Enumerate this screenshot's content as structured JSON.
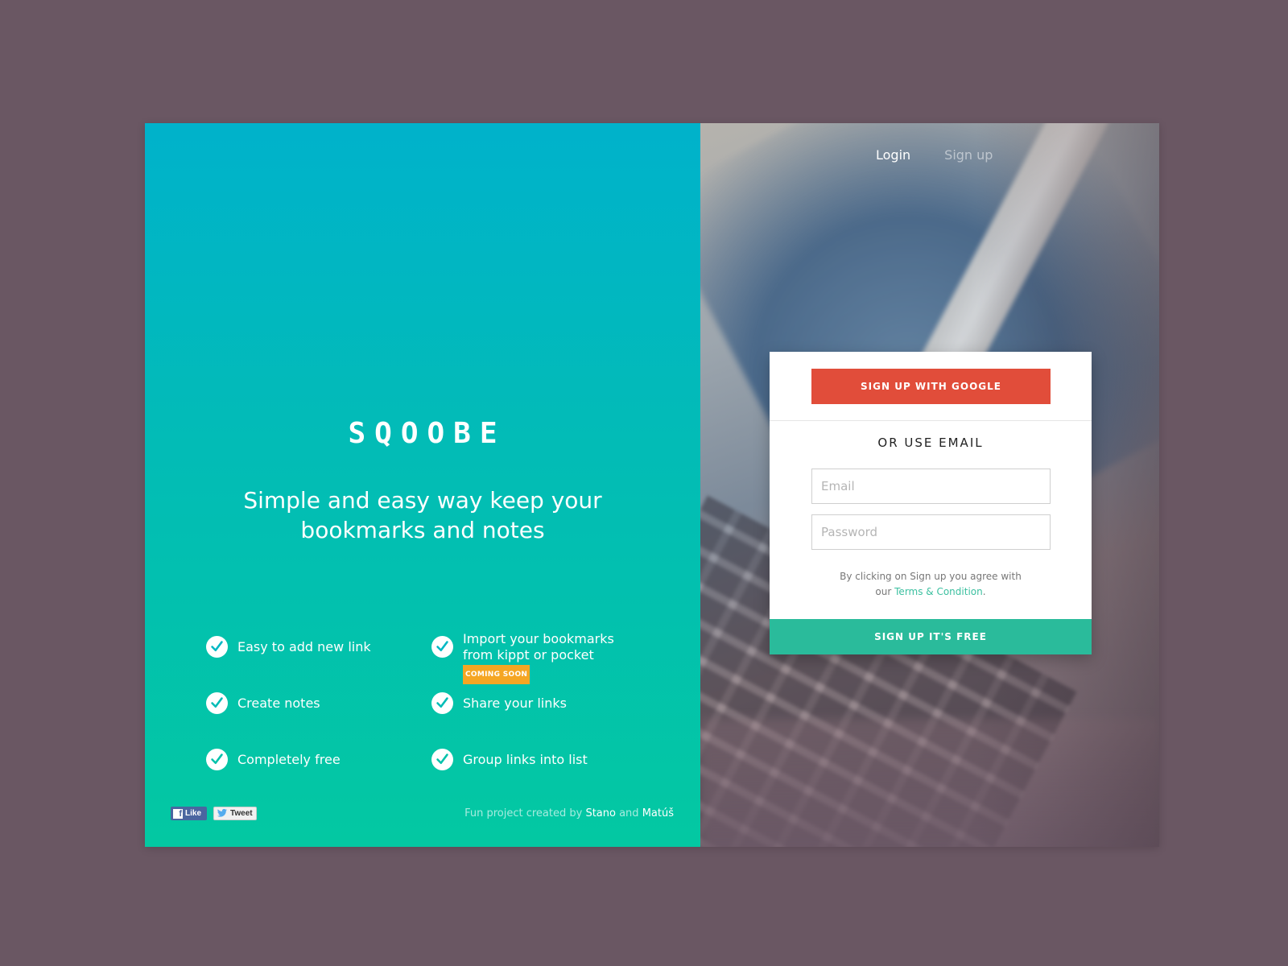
{
  "brand": {
    "logo": "SQOOBE"
  },
  "hero": {
    "tagline_line1": "Simple and easy way keep your",
    "tagline_line2": "bookmarks and notes"
  },
  "features": [
    {
      "label": "Easy to add new link"
    },
    {
      "label_line1": "Import your bookmarks",
      "label_line2": "from kippt or pocket",
      "badge": "COMING SOON"
    },
    {
      "label": "Create notes"
    },
    {
      "label": "Share your links"
    },
    {
      "label": "Completely free"
    },
    {
      "label": "Group links into list"
    }
  ],
  "social": {
    "like_label": "Like",
    "tweet_label": "Tweet"
  },
  "credits": {
    "prefix": "Fun project created by",
    "author1": "Stano",
    "conjunction": "and",
    "author2": "Matúš"
  },
  "nav": {
    "login": "Login",
    "signup": "Sign up"
  },
  "form": {
    "google_button": "SIGN UP WITH GOOGLE",
    "or_email": "OR USE EMAIL",
    "email_placeholder": "Email",
    "password_placeholder": "Password",
    "terms_line1": "By clicking on Sign up you agree with",
    "terms_prefix": "our",
    "terms_link": "Terms & Condition",
    "terms_suffix": ".",
    "submit_button": "SIGN UP IT'S FREE"
  },
  "colors": {
    "background": "#6a5763",
    "gradient_top": "#00b2cb",
    "gradient_bottom": "#03c8a2",
    "google_red": "#e14d3a",
    "accent_green": "#2abb9b",
    "badge_orange": "#f5a623"
  },
  "icons": {
    "feature": "check-circle-icon",
    "facebook": "facebook-icon",
    "twitter": "twitter-bird-icon"
  }
}
